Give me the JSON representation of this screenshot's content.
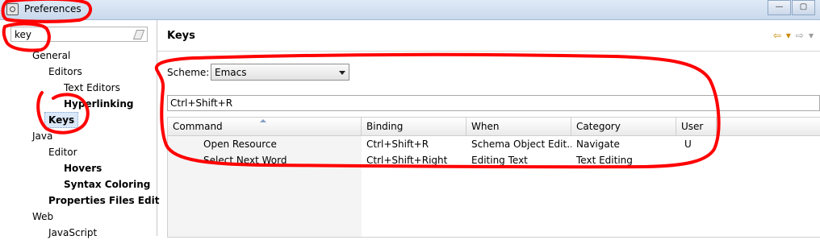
{
  "window": {
    "title": "Preferences",
    "min_glyph": "—",
    "max_glyph": "▢"
  },
  "filter": {
    "value": "key",
    "placeholder": ""
  },
  "tree": [
    {
      "label": "General",
      "bold": false
    },
    {
      "label": "Editors",
      "bold": false
    },
    {
      "label": "Text Editors",
      "bold": false
    },
    {
      "label": "Hyperlinking",
      "bold": true
    },
    {
      "label": "Keys",
      "bold": true,
      "selected": true
    },
    {
      "label": "Java",
      "bold": false
    },
    {
      "label": "Editor",
      "bold": false
    },
    {
      "label": "Hovers",
      "bold": true
    },
    {
      "label": "Syntax Coloring",
      "bold": true
    },
    {
      "label": "Properties Files Edit",
      "bold": true
    },
    {
      "label": "Web",
      "bold": false
    },
    {
      "label": "JavaScript",
      "bold": false
    }
  ],
  "page": {
    "title": "Keys",
    "nav": {
      "back": "⇦",
      "dropdown": "▾",
      "forward": "⇨"
    }
  },
  "scheme": {
    "label": "Scheme:",
    "value": "Emacs"
  },
  "search": {
    "value": "Ctrl+Shift+R"
  },
  "table": {
    "columns": [
      "Command",
      "Binding",
      "When",
      "Category",
      "User"
    ],
    "rows": [
      {
        "command": "Open Resource",
        "binding": "Ctrl+Shift+R",
        "when": "Schema Object Edit...",
        "category": "Navigate",
        "user": "U"
      },
      {
        "command": "Select Next Word",
        "binding": "Ctrl+Shift+Right",
        "when": "Editing Text",
        "category": "Text Editing",
        "user": ""
      }
    ]
  },
  "colors": {
    "annotation": "#ff0000",
    "selection": "#dbe8f8"
  }
}
